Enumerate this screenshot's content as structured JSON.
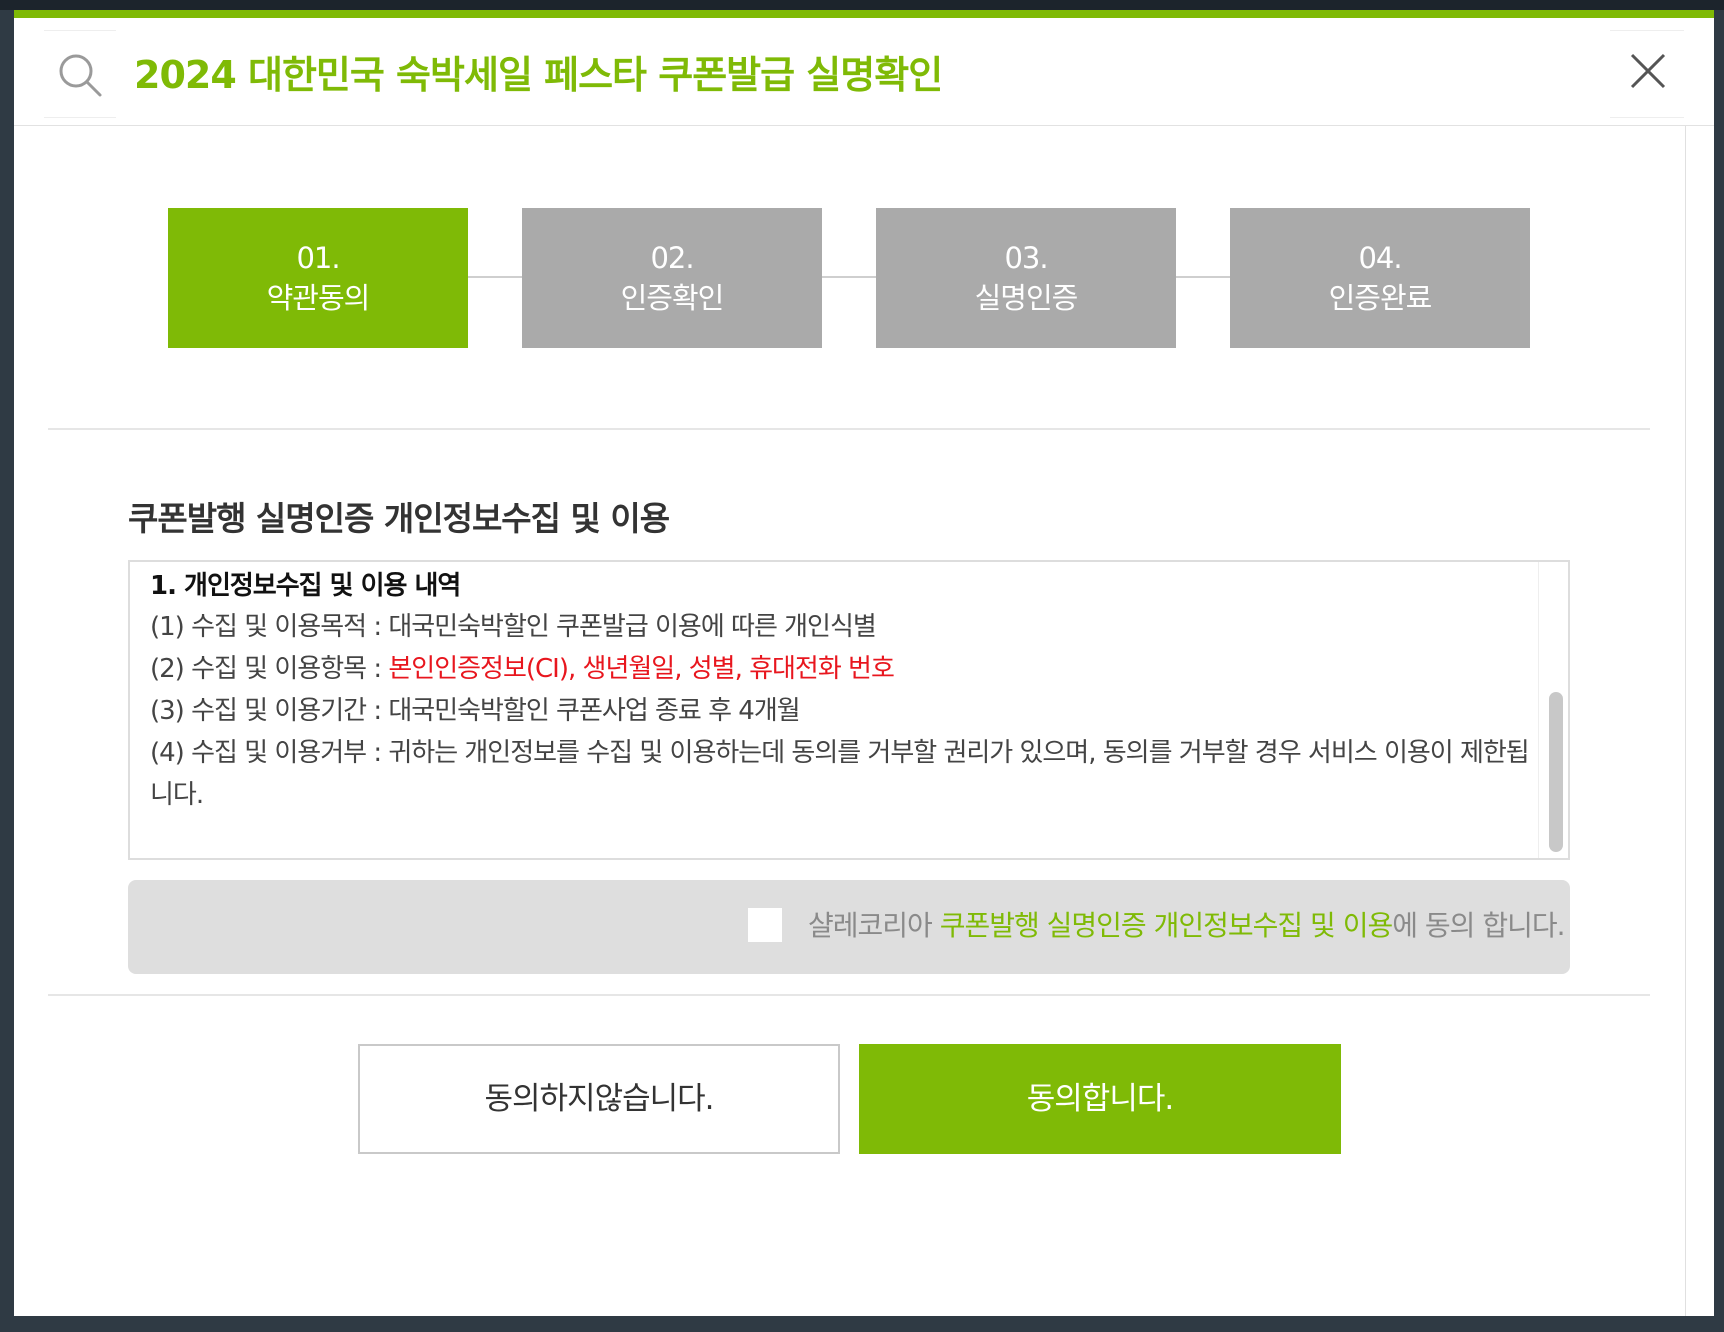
{
  "header": {
    "title": "2024 대한민국 숙박세일 페스타 쿠폰발급 실명확인",
    "search_icon": "search-icon",
    "close_icon": "close-icon"
  },
  "steps": [
    {
      "number": "01.",
      "label": "약관동의",
      "active": true
    },
    {
      "number": "02.",
      "label": "인증확인",
      "active": false
    },
    {
      "number": "03.",
      "label": "실명인증",
      "active": false
    },
    {
      "number": "04.",
      "label": "인증완료",
      "active": false
    }
  ],
  "section_title": "쿠폰발행 실명인증 개인정보수집 및 이용",
  "terms": {
    "heading": "1. 개인정보수집 및 이용 내역",
    "line1": "(1) 수집 및 이용목적 : 대국민숙박할인 쿠폰발급 이용에 따른 개인식별",
    "line2_prefix": "(2) 수집 및 이용항목 : ",
    "line2_highlight": "본인인증정보(CI), 생년월일, 성별, 휴대전화 번호",
    "line3": "(3) 수집 및 이용기간 : 대국민숙박할인 쿠폰사업 종료 후 4개월",
    "line4": "(4) 수집 및 이용거부 : 귀하는 개인정보를 수집 및 이용하는데 동의를 거부할 권리가 있으며, 동의를 거부할 경우 서비스 이용이 제한됩니다."
  },
  "agree": {
    "prefix": "샬레코리아 ",
    "highlight": "쿠폰발행 실명인증 개인정보수집 및 이용",
    "suffix": "에 동의 합니다.",
    "checked": false
  },
  "buttons": {
    "disagree": "동의하지않습니다.",
    "agree": "동의합니다."
  },
  "colors": {
    "accent": "#7fba06",
    "inactive_step": "#aaaaaa",
    "highlight_red": "#e8161e"
  }
}
